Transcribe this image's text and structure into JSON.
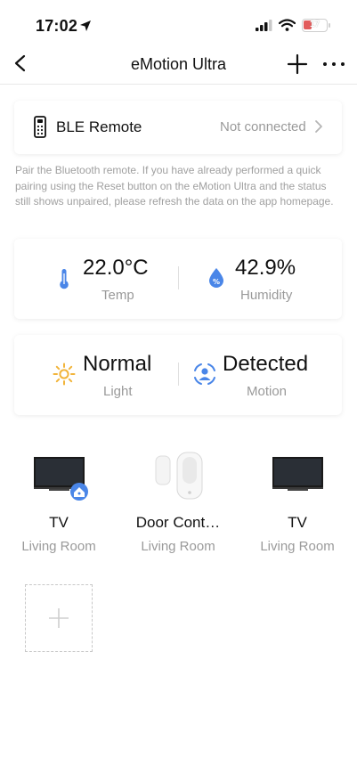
{
  "status_bar": {
    "time": "17:02",
    "battery": "17",
    "battery_color": "#e25b5b"
  },
  "navbar": {
    "title": "eMotion Ultra"
  },
  "ble": {
    "label": "BLE Remote",
    "status": "Not connected"
  },
  "hint": "Pair the Bluetooth remote. If you have already performed a quick pairing using the Reset button on the eMotion Ultra and the status still shows unpaired, please refresh the data on the app homepage.",
  "sensors": {
    "temp": {
      "value": "22.0°C",
      "label": "Temp"
    },
    "humidity": {
      "value": "42.9%",
      "label": "Humidity"
    },
    "light": {
      "value": "Normal",
      "label": "Light"
    },
    "motion": {
      "value": "Detected",
      "label": "Motion"
    }
  },
  "devices": [
    {
      "name": "TV",
      "room": "Living Room",
      "icon": "tv-icon"
    },
    {
      "name": "Door Cont…",
      "room": "Living Room",
      "icon": "door-sensor-icon"
    },
    {
      "name": "TV",
      "room": "Living Room",
      "icon": "tv-icon"
    }
  ],
  "colors": {
    "accent_blue": "#4a86e8",
    "sun_yellow": "#f2b43a"
  }
}
